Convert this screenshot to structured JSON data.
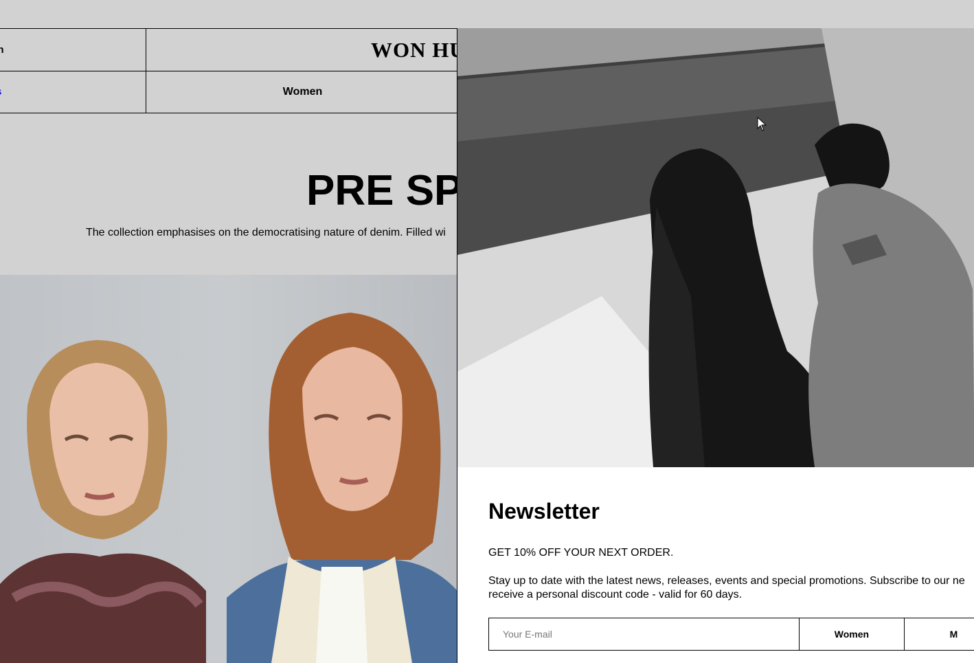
{
  "header": {
    "search_label": "ch",
    "logo_text": "WON HU",
    "left_nav_label": "s",
    "women_label": "Women"
  },
  "hero": {
    "title": "PRE SP",
    "description": "The collection emphasises on the democratising nature of denim. Filled wi"
  },
  "newsletter": {
    "title": "Newsletter",
    "offer": "GET 10% OFF YOUR NEXT ORDER.",
    "description": "Stay up to date with the latest news, releases, events and special promotions. Subscribe to our ne\nreceive a personal discount code - valid for 60 days.",
    "email_placeholder": "Your E-mail",
    "women_button": "Women",
    "men_button": "M"
  },
  "colors": {
    "background": "#d2d2d2",
    "link_blue": "#1a13d6",
    "panel_background": "#ffffff"
  }
}
